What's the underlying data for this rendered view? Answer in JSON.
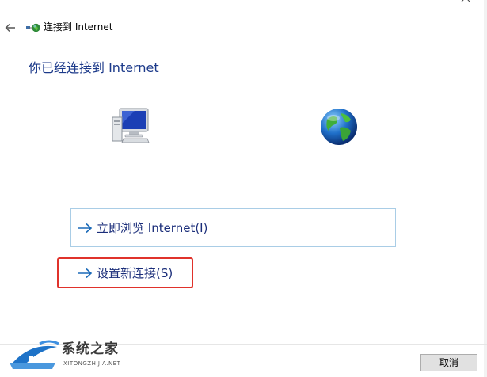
{
  "window": {
    "title": "连接到 Internet",
    "heading": "你已经连接到 Internet"
  },
  "icons": {
    "back": "back-arrow-icon",
    "network": "network-connection-icon",
    "computer": "computer-icon",
    "globe": "globe-icon",
    "option_arrow": "right-arrow-icon"
  },
  "options": [
    {
      "label": "立即浏览 Internet(I)"
    },
    {
      "label": "设置新连接(S)"
    }
  ],
  "footer": {
    "cancel_label": "取消"
  },
  "watermark": {
    "name": "系统之家",
    "url": "XITONGZHIJIA.NET"
  },
  "colors": {
    "heading": "#1c3a8a",
    "option_text": "#1b2e7a",
    "option_border": "#a9cde6",
    "highlight_border": "#e0322b",
    "line": "#6a6a6a"
  }
}
